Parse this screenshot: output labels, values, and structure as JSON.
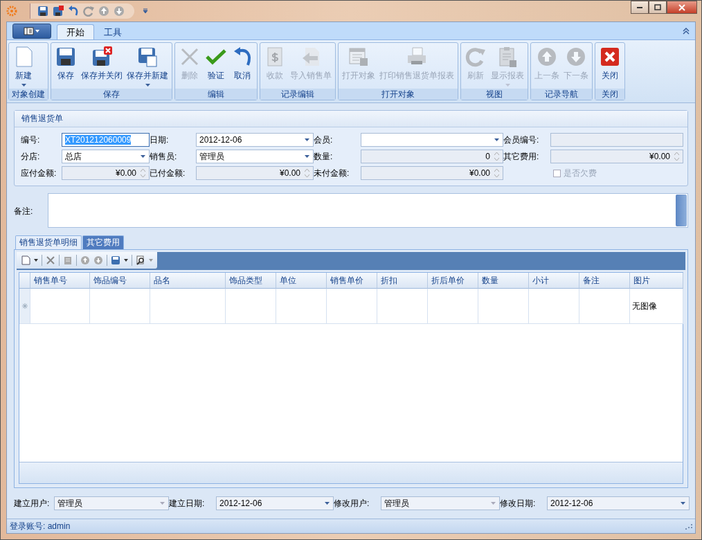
{
  "ribbon": {
    "tabs": [
      {
        "label": "开始",
        "selected": true
      },
      {
        "label": "工具",
        "selected": false
      }
    ],
    "groups": [
      {
        "title": "对象创建",
        "buttons": [
          {
            "label": "新建",
            "disabled": false,
            "dropdown": true
          }
        ]
      },
      {
        "title": "保存",
        "buttons": [
          {
            "label": "保存",
            "disabled": false,
            "dropdown": false
          },
          {
            "label": "保存并关闭",
            "disabled": false,
            "dropdown": false
          },
          {
            "label": "保存并新建",
            "disabled": false,
            "dropdown": true
          }
        ]
      },
      {
        "title": "编辑",
        "buttons": [
          {
            "label": "删除",
            "disabled": true,
            "dropdown": false
          },
          {
            "label": "验证",
            "disabled": false,
            "dropdown": false
          },
          {
            "label": "取消",
            "disabled": false,
            "dropdown": false
          }
        ]
      },
      {
        "title": "记录编辑",
        "buttons": [
          {
            "label": "收款",
            "disabled": true,
            "dropdown": false
          },
          {
            "label": "导入销售单",
            "disabled": true,
            "dropdown": false
          }
        ]
      },
      {
        "title": "打开对象",
        "buttons": [
          {
            "label": "打开对象",
            "disabled": true,
            "dropdown": false
          },
          {
            "label": "打印销售退货单报表",
            "disabled": true,
            "dropdown": false
          }
        ]
      },
      {
        "title": "视图",
        "buttons": [
          {
            "label": "刷新",
            "disabled": true,
            "dropdown": false
          },
          {
            "label": "显示报表",
            "disabled": true,
            "dropdown": true
          }
        ]
      },
      {
        "title": "记录导航",
        "buttons": [
          {
            "label": "上一条",
            "disabled": true,
            "dropdown": false
          },
          {
            "label": "下一条",
            "disabled": true,
            "dropdown": false
          }
        ]
      },
      {
        "title": "关闭",
        "buttons": [
          {
            "label": "关闭",
            "disabled": false,
            "dropdown": false
          }
        ]
      }
    ]
  },
  "form": {
    "title": "销售退货单",
    "fields": [
      {
        "label": "编号:",
        "value": "XT201212060009",
        "kind": "text",
        "readonly": false,
        "highlighted": true
      },
      {
        "label": "日期:",
        "value": "2012-12-06",
        "kind": "combo",
        "readonly": false,
        "highlighted": false
      },
      {
        "label": "会员:",
        "kind": "combo",
        "readonly": false,
        "highlighted": false
      },
      {
        "label": "会员编号:",
        "kind": "text",
        "readonly": true,
        "highlighted": false
      },
      {
        "label": "分店:",
        "value": "总店",
        "kind": "combo",
        "readonly": false,
        "highlighted": false
      },
      {
        "label": "销售员:",
        "value": "管理员",
        "kind": "combo",
        "readonly": false,
        "highlighted": false
      },
      {
        "label": "数量:",
        "value": "0",
        "kind": "spin",
        "readonly": true,
        "highlighted": false
      },
      {
        "label": "其它费用:",
        "value": "¥0.00",
        "kind": "spin",
        "readonly": true,
        "highlighted": false
      },
      {
        "label": "应付金额:",
        "value": "¥0.00",
        "kind": "spin",
        "readonly": true,
        "highlighted": false
      },
      {
        "label": "已付金额:",
        "value": "¥0.00",
        "kind": "spin",
        "readonly": true,
        "highlighted": false
      },
      {
        "label": "未付金额:",
        "value": "¥0.00",
        "kind": "spin",
        "readonly": true,
        "highlighted": false
      }
    ],
    "checkbox": {
      "label": "是否欠费",
      "checked": false,
      "disabled": true
    }
  },
  "remark": {
    "label": "备注:"
  },
  "detail_tabs": [
    {
      "label": "销售退货单明细",
      "selected": true
    },
    {
      "label": "其它费用",
      "selected": false
    }
  ],
  "table": {
    "columns": [
      "销售单号",
      "饰品编号",
      "品名",
      "饰品类型",
      "单位",
      "销售单价",
      "折扣",
      "折后单价",
      "数量",
      "小计",
      "备注",
      "图片"
    ],
    "rows": [
      {
        "new_row": true,
        "cells": [
          "",
          "",
          "",
          "",
          "",
          "",
          "",
          "",
          "",
          "",
          "",
          "无图像"
        ]
      }
    ]
  },
  "footer": [
    {
      "label": "建立用户:",
      "value": "管理员",
      "readonly": true
    },
    {
      "label": "建立日期:",
      "value": "2012-12-06",
      "readonly": false
    },
    {
      "label": "修改用户:",
      "value": "管理员",
      "readonly": true
    },
    {
      "label": "修改日期:",
      "value": "2012-12-06",
      "readonly": false
    }
  ],
  "status_bar": "登录账号: admin"
}
